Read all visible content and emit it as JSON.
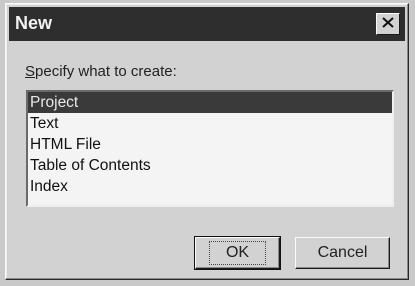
{
  "dialog": {
    "title": "New",
    "close_icon": "close-icon",
    "prompt_accesskey": "S",
    "prompt_rest": "pecify what to create:"
  },
  "list": {
    "items": [
      {
        "label": "Project",
        "selected": true
      },
      {
        "label": "Text",
        "selected": false
      },
      {
        "label": "HTML File",
        "selected": false
      },
      {
        "label": "Table of Contents",
        "selected": false
      },
      {
        "label": "Index",
        "selected": false
      }
    ]
  },
  "buttons": {
    "ok_label": "OK",
    "cancel_label": "Cancel"
  },
  "colors": {
    "titlebar": "#2e2e2e",
    "selection": "#3a3a3a",
    "face": "#d2d2d2"
  }
}
